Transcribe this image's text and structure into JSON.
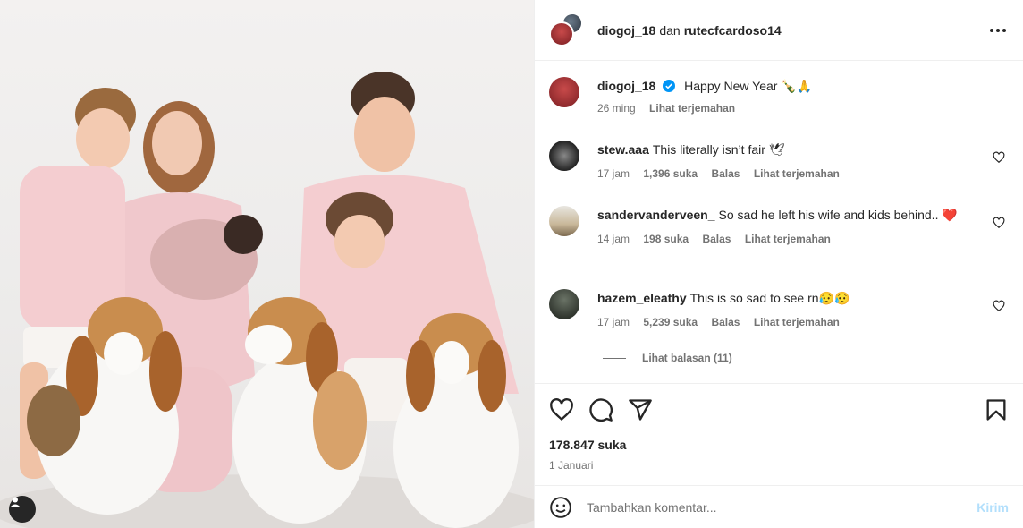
{
  "header": {
    "user1": "diogoj_18",
    "joiner": "dan",
    "user2": "rutecfcardoso14"
  },
  "caption": {
    "username": "diogoj_18",
    "text": "Happy New Year 🍾🙏",
    "time": "26 ming",
    "translate": "Lihat terjemahan"
  },
  "comments": [
    {
      "username": "stew.aaa",
      "text": "This literally isn’t fair 🕊",
      "time": "17 jam",
      "likes": "1,396 suka",
      "reply": "Balas",
      "translate": "Lihat terjemahan"
    },
    {
      "username": "sandervanderveen_",
      "text": "So sad he left his wife and kids behind.. ❤️",
      "time": "14 jam",
      "likes": "198 suka",
      "reply": "Balas",
      "translate": "Lihat terjemahan"
    },
    {
      "username": "hazem_eleathy",
      "text": "This is so sad to see rn😥😥",
      "time": "17 jam",
      "likes": "5,239 suka",
      "reply": "Balas",
      "translate": "Lihat terjemahan"
    }
  ],
  "view_replies": "Lihat balasan (11)",
  "post": {
    "likes": "178.847 suka",
    "date": "1 Januari"
  },
  "add_comment": {
    "placeholder": "Tambahkan komentar...",
    "post_label": "Kirim"
  },
  "colors": {
    "verified": "#0095f6",
    "post_disabled": "#b2dffc",
    "meta_gray": "#737373"
  }
}
